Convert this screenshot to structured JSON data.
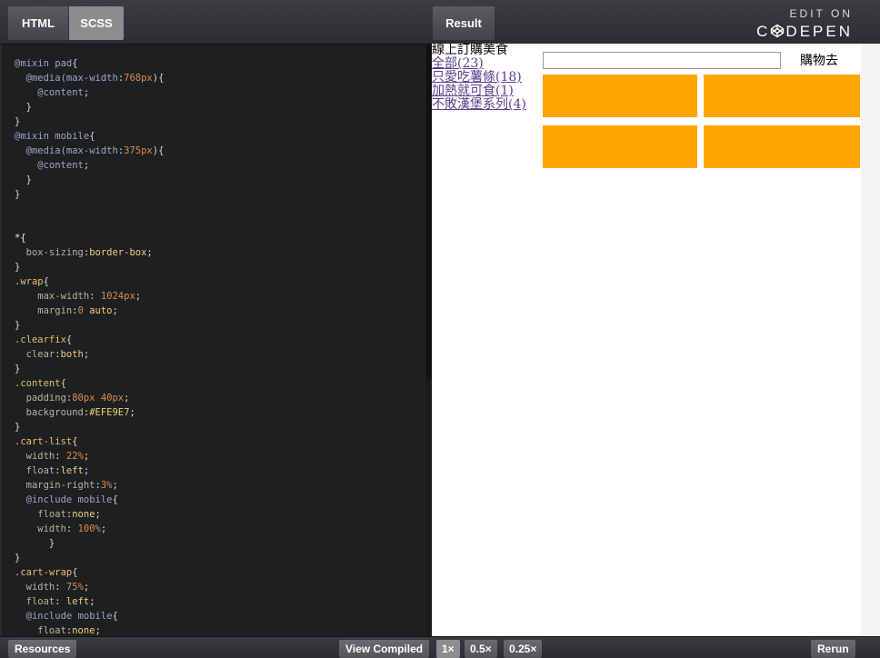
{
  "editor": {
    "tabs": {
      "html": "HTML",
      "scss": "SCSS"
    },
    "code_lines": [
      [
        [
          "@mixin ",
          "kw"
        ],
        [
          "pad",
          "kw"
        ],
        [
          "{",
          "p"
        ]
      ],
      [
        [
          "  @media(",
          "kw"
        ],
        [
          "max-width",
          "kw"
        ],
        [
          ":",
          "p"
        ],
        [
          "768px",
          "num"
        ],
        [
          "){",
          "p"
        ]
      ],
      [
        [
          "    @content",
          "kw"
        ],
        [
          ";",
          "p"
        ]
      ],
      [
        [
          "  }",
          "p"
        ]
      ],
      [
        [
          "}",
          "p"
        ]
      ],
      [
        [
          "@mixin ",
          "kw"
        ],
        [
          "mobile",
          "kw"
        ],
        [
          "{",
          "p"
        ]
      ],
      [
        [
          "  @media(",
          "kw"
        ],
        [
          "max-width",
          "kw"
        ],
        [
          ":",
          "p"
        ],
        [
          "375px",
          "num"
        ],
        [
          "){",
          "p"
        ]
      ],
      [
        [
          "    @content",
          "kw"
        ],
        [
          ";",
          "p"
        ]
      ],
      [
        [
          "  }",
          "p"
        ]
      ],
      [
        [
          "}",
          "p"
        ]
      ],
      [],
      [],
      [
        [
          "*{",
          "sel"
        ]
      ],
      [
        [
          "  box-sizing",
          "prop"
        ],
        [
          ":",
          "p"
        ],
        [
          "border-box",
          "val"
        ],
        [
          ";",
          "p"
        ]
      ],
      [
        [
          "}",
          "p"
        ]
      ],
      [
        [
          ".wrap",
          "sel2"
        ],
        [
          "{",
          "p"
        ]
      ],
      [
        [
          "    max-width",
          "prop"
        ],
        [
          ": ",
          "p"
        ],
        [
          "1024px",
          "num"
        ],
        [
          ";",
          "p"
        ]
      ],
      [
        [
          "    margin",
          "prop"
        ],
        [
          ":",
          "p"
        ],
        [
          "0",
          "num"
        ],
        [
          " ",
          "p"
        ],
        [
          "auto",
          "val"
        ],
        [
          ";",
          "p"
        ]
      ],
      [
        [
          "}",
          "p"
        ]
      ],
      [
        [
          ".clearfix",
          "sel2"
        ],
        [
          "{",
          "p"
        ]
      ],
      [
        [
          "  clear",
          "prop"
        ],
        [
          ":",
          "p"
        ],
        [
          "both",
          "val"
        ],
        [
          ";",
          "p"
        ]
      ],
      [
        [
          "}",
          "p"
        ]
      ],
      [
        [
          ".content",
          "sel2"
        ],
        [
          "{",
          "p"
        ]
      ],
      [
        [
          "  padding",
          "prop"
        ],
        [
          ":",
          "p"
        ],
        [
          "80px 40px",
          "num"
        ],
        [
          ";",
          "p"
        ]
      ],
      [
        [
          "  background",
          "prop"
        ],
        [
          ":",
          "p"
        ],
        [
          "#EFE9E7",
          "val"
        ],
        [
          ";",
          "p"
        ]
      ],
      [
        [
          "}",
          "p"
        ]
      ],
      [
        [
          ".cart-list",
          "sel2"
        ],
        [
          "{",
          "p"
        ]
      ],
      [
        [
          "  width",
          "prop"
        ],
        [
          ": ",
          "p"
        ],
        [
          "22%",
          "num"
        ],
        [
          ";",
          "p"
        ]
      ],
      [
        [
          "  float",
          "prop"
        ],
        [
          ":",
          "p"
        ],
        [
          "left",
          "val"
        ],
        [
          ";",
          "p"
        ]
      ],
      [
        [
          "  margin-right",
          "prop"
        ],
        [
          ":",
          "p"
        ],
        [
          "3%",
          "num"
        ],
        [
          ";",
          "p"
        ]
      ],
      [
        [
          "  @include ",
          "kw"
        ],
        [
          "mobile",
          "kw"
        ],
        [
          "{",
          "p"
        ]
      ],
      [
        [
          "    float",
          "prop"
        ],
        [
          ":",
          "p"
        ],
        [
          "none",
          "val"
        ],
        [
          ";",
          "p"
        ]
      ],
      [
        [
          "    width",
          "prop"
        ],
        [
          ": ",
          "p"
        ],
        [
          "100%",
          "num"
        ],
        [
          ";",
          "p"
        ]
      ],
      [
        [
          "      }",
          "p"
        ]
      ],
      [
        [
          "}",
          "p"
        ]
      ],
      [
        [
          ".cart-wrap",
          "sel2"
        ],
        [
          "{",
          "p"
        ]
      ],
      [
        [
          "  width",
          "prop"
        ],
        [
          ": ",
          "p"
        ],
        [
          "75%",
          "num"
        ],
        [
          ";",
          "p"
        ]
      ],
      [
        [
          "  float",
          "prop"
        ],
        [
          ": ",
          "p"
        ],
        [
          "left",
          "val"
        ],
        [
          ";",
          "p"
        ]
      ],
      [
        [
          "  @include ",
          "kw"
        ],
        [
          "mobile",
          "kw"
        ],
        [
          "{",
          "p"
        ]
      ],
      [
        [
          "    float",
          "prop"
        ],
        [
          ":",
          "p"
        ],
        [
          "none",
          "val"
        ],
        [
          ";",
          "p"
        ]
      ]
    ]
  },
  "result": {
    "tab_label": "Result",
    "edit_on": "EDIT ON",
    "codepen_brand": "DEPEN",
    "codepen_prefix": "C",
    "cart_list": {
      "title": "線上訂購美食",
      "items": [
        "全部(23)",
        "只愛吃薯條(18)",
        "加熱就可食(1)",
        "不敗漢堡系列(4)"
      ]
    },
    "cart_wrap": {
      "search_value": "",
      "go_label": "購物去",
      "product_color": "#ffa500"
    }
  },
  "bottom_bar": {
    "resources": "Resources",
    "view_compiled": "View Compiled",
    "zoom": [
      "1×",
      "0.5×",
      "0.25×"
    ],
    "rerun": "Rerun"
  }
}
